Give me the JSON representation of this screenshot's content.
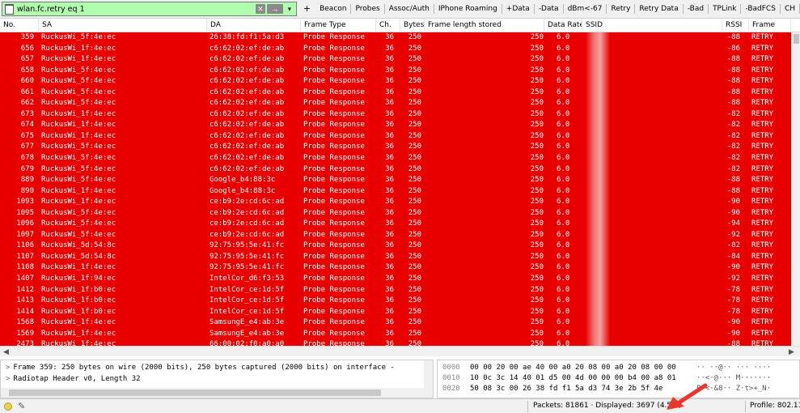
{
  "filter": {
    "value": "wlan.fc.retry eq 1",
    "clear_glyph": "✕",
    "apply_glyph": "→",
    "dropdown_glyph": "▾",
    "add_glyph": "+"
  },
  "toolbar_buttons": [
    "Beacon",
    "Probes",
    "Assoc/Auth",
    "IPhone Roaming",
    "+Data",
    "-Data",
    "dBm<-67",
    "Retry",
    "Retry Data",
    "-Bad",
    "TPLink",
    "-BadFCS",
    "CH"
  ],
  "columns": [
    "No.",
    "SA",
    "DA",
    "Frame Type",
    "Ch.",
    "Bytes",
    "Frame length stored",
    "Data Rate",
    "SSID",
    "RSSI",
    "Frame"
  ],
  "row_color": "#e80000",
  "packets": [
    [
      "359",
      "RuckusWi_5f:4e:ec",
      "26:38:fd:f1:5a:d3",
      "Probe Response",
      "36",
      "250",
      "250",
      "6.0",
      "-88",
      "RETRY"
    ],
    [
      "656",
      "RuckusWi_1f:4e:ec",
      "c6:62:02:ef:de:ab",
      "Probe Response",
      "36",
      "250",
      "250",
      "6.0",
      "-86",
      "RETRY"
    ],
    [
      "657",
      "RuckusWi_1f:4e:ec",
      "c6:62:02:ef:de:ab",
      "Probe Response",
      "36",
      "250",
      "250",
      "6.0",
      "-88",
      "RETRY"
    ],
    [
      "658",
      "RuckusWi_5f:4e:ec",
      "c6:62:02:ef:de:ab",
      "Probe Response",
      "36",
      "250",
      "250",
      "6.0",
      "-88",
      "RETRY"
    ],
    [
      "660",
      "RuckusWi_5f:4e:ec",
      "c6:62:02:ef:de:ab",
      "Probe Response",
      "36",
      "250",
      "250",
      "6.0",
      "-88",
      "RETRY"
    ],
    [
      "661",
      "RuckusWi_5f:4e:ec",
      "c6:62:02:ef:de:ab",
      "Probe Response",
      "36",
      "250",
      "250",
      "6.0",
      "-88",
      "RETRY"
    ],
    [
      "662",
      "RuckusWi_5f:4e:ec",
      "c6:62:02:ef:de:ab",
      "Probe Response",
      "36",
      "250",
      "250",
      "6.0",
      "-88",
      "RETRY"
    ],
    [
      "673",
      "RuckusWi_1f:4e:ec",
      "c6:62:02:ef:de:ab",
      "Probe Response",
      "36",
      "250",
      "250",
      "6.0",
      "-82",
      "RETRY"
    ],
    [
      "674",
      "RuckusWi_1f:4e:ec",
      "c6:62:02:ef:de:ab",
      "Probe Response",
      "36",
      "250",
      "250",
      "6.0",
      "-82",
      "RETRY"
    ],
    [
      "675",
      "RuckusWi_1f:4e:ec",
      "c6:62:02:ef:de:ab",
      "Probe Response",
      "36",
      "250",
      "250",
      "6.0",
      "-82",
      "RETRY"
    ],
    [
      "677",
      "RuckusWi_5f:4e:ec",
      "c6:62:02:ef:de:ab",
      "Probe Response",
      "36",
      "250",
      "250",
      "6.0",
      "-82",
      "RETRY"
    ],
    [
      "678",
      "RuckusWi_5f:4e:ec",
      "c6:62:02:ef:de:ab",
      "Probe Response",
      "36",
      "250",
      "250",
      "6.0",
      "-82",
      "RETRY"
    ],
    [
      "679",
      "RuckusWi_5f:4e:ec",
      "c6:62:02:ef:de:ab",
      "Probe Response",
      "36",
      "250",
      "250",
      "6.0",
      "-82",
      "RETRY"
    ],
    [
      "889",
      "RuckusWi_5f:4e:ec",
      "Google_b4:88:3c",
      "Probe Response",
      "36",
      "250",
      "250",
      "6.0",
      "-88",
      "RETRY"
    ],
    [
      "890",
      "RuckusWi_1f:4e:ec",
      "Google_b4:88:3c",
      "Probe Response",
      "36",
      "250",
      "250",
      "6.0",
      "-88",
      "RETRY"
    ],
    [
      "1093",
      "RuckusWi_1f:4e:ec",
      "ce:b9:2e:cd:6c:ad",
      "Probe Response",
      "36",
      "250",
      "250",
      "6.0",
      "-90",
      "RETRY"
    ],
    [
      "1095",
      "RuckusWi_5f:4e:ec",
      "ce:b9:2e:cd:6c:ad",
      "Probe Response",
      "36",
      "250",
      "250",
      "6.0",
      "-90",
      "RETRY"
    ],
    [
      "1096",
      "RuckusWi_5f:4e:ec",
      "ce:b9:2e:cd:6c:ad",
      "Probe Response",
      "36",
      "250",
      "250",
      "6.0",
      "-94",
      "RETRY"
    ],
    [
      "1097",
      "RuckusWi_5f:4e:ec",
      "ce:b9:2e:cd:6c:ad",
      "Probe Response",
      "36",
      "250",
      "250",
      "6.0",
      "-92",
      "RETRY"
    ],
    [
      "1106",
      "RuckusWi_5d:54:8c",
      "92:75:95:5e:41:fc",
      "Probe Response",
      "36",
      "250",
      "250",
      "6.0",
      "-82",
      "RETRY"
    ],
    [
      "1107",
      "RuckusWi_5d:54:8c",
      "92:75:95:5e:41:fc",
      "Probe Response",
      "36",
      "250",
      "250",
      "6.0",
      "-84",
      "RETRY"
    ],
    [
      "1108",
      "RuckusWi_1f:4e:ec",
      "92:75:95:5e:41:fc",
      "Probe Response",
      "36",
      "250",
      "250",
      "6.0",
      "-90",
      "RETRY"
    ],
    [
      "1407",
      "RuckusWi_1f:94:ec",
      "IntelCor_d6:f3:53",
      "Probe Response",
      "36",
      "250",
      "250",
      "6.0",
      "-92",
      "RETRY"
    ],
    [
      "1412",
      "RuckusWi_1f:b0:ec",
      "IntelCor_ce:1d:5f",
      "Probe Response",
      "36",
      "250",
      "250",
      "6.0",
      "-78",
      "RETRY"
    ],
    [
      "1413",
      "RuckusWi_1f:b0:ec",
      "IntelCor_ce:1d:5f",
      "Probe Response",
      "36",
      "250",
      "250",
      "6.0",
      "-78",
      "RETRY"
    ],
    [
      "1414",
      "RuckusWi_1f:b0:ec",
      "IntelCor_ce:1d:5f",
      "Probe Response",
      "36",
      "250",
      "250",
      "6.0",
      "-78",
      "RETRY"
    ],
    [
      "1568",
      "RuckusWi_1f:4e:ec",
      "SamsungE_e4:ab:3e",
      "Probe Response",
      "36",
      "250",
      "250",
      "6.0",
      "-90",
      "RETRY"
    ],
    [
      "1569",
      "RuckusWi_1f:4e:ec",
      "SamsungE_e4:ab:3e",
      "Probe Response",
      "36",
      "250",
      "250",
      "6.0",
      "-90",
      "RETRY"
    ],
    [
      "2473",
      "RuckusWi_1f:4e:ec",
      "66:00:02:f0:a0:a0",
      "Probe Response",
      "36",
      "250",
      "250",
      "6.0",
      "-88",
      "RETRY"
    ]
  ],
  "details": [
    "Frame 359: 250 bytes on wire (2000 bits), 250 bytes captured (2000 bits) on interface -",
    "Radiotap Header v0, Length 32"
  ],
  "bytes": [
    {
      "offset": "0000",
      "hex": "00 00 20 00 ae 40 00 a0  20 08 00 a0 20 08 00 00",
      "ascii": "·· ··@·· ··· ····"
    },
    {
      "offset": "0010",
      "hex": "10 0c 3c 14 40 01 d5 00  4d 00 00 00 b4 00 a8 01",
      "ascii": "··<·@··· M·······"
    },
    {
      "offset": "0020",
      "hex": "50 08 3c 00 26 38 fd f1  5a d3 74 3e 2b 5f 4e",
      "ascii": "P·<·&8·· Z·t>+_N·"
    }
  ],
  "status": {
    "packets": "Packets: 81861 · Displayed: 3697 (4.5%)",
    "profile": "Profile: 802.11"
  },
  "icons": {
    "status_dot": "yellow-circle-icon",
    "edit": "edit-comment-icon",
    "arrow": "red-annotation-arrow-icon"
  },
  "arrow_color": "#e8372c"
}
